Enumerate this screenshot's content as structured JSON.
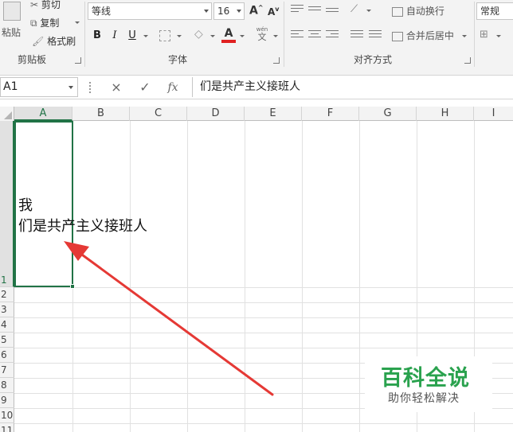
{
  "ribbon": {
    "clipboard": {
      "paste_label": "粘贴",
      "cut_label": "剪切",
      "copy_label": "复制",
      "format_painter_label": "格式刷",
      "group_label": "剪贴板"
    },
    "font": {
      "font_name": "等线",
      "font_size": "16",
      "bold": "B",
      "italic": "I",
      "underline": "U",
      "font_color_letter": "A",
      "phonetic_top": "wén",
      "phonetic_char": "文",
      "grow_font": "A",
      "shrink_font": "A",
      "group_label": "字体",
      "font_color_hex": "#e02020"
    },
    "alignment": {
      "wrap_text_label": "自动换行",
      "merge_center_label": "合并后居中",
      "group_label": "对齐方式"
    },
    "number": {
      "format_value": "常规"
    }
  },
  "formula_bar": {
    "name_box": "A1",
    "cancel_icon": "×",
    "enter_icon": "✓",
    "fx_icon": "fx",
    "content": "们是共产主义接班人"
  },
  "grid": {
    "columns": [
      "A",
      "B",
      "C",
      "D",
      "E",
      "F",
      "G",
      "H",
      "I"
    ],
    "rows": [
      "1",
      "2",
      "3",
      "4",
      "5",
      "6",
      "7",
      "8",
      "9",
      "10",
      "11"
    ],
    "selected_cell": "A1",
    "cell_a1_text": "我\n们是共产主义接班人",
    "accent_color": "#217346"
  },
  "annotation": {
    "arrow_color": "#e53935"
  },
  "watermark": {
    "title": "百科全说",
    "subtitle": "助你轻松解决"
  }
}
